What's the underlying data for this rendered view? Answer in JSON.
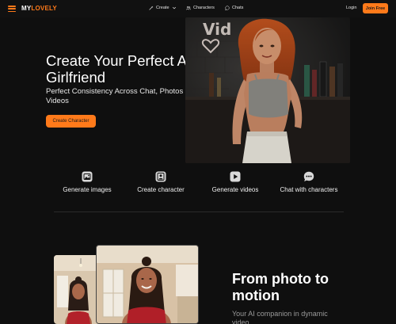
{
  "nav": {
    "logo_my": "MY",
    "logo_lovely": "LOVELY",
    "items": [
      {
        "label": "Create",
        "icon": "wand-icon"
      },
      {
        "label": "Characters",
        "icon": "people-icon"
      },
      {
        "label": "Chats",
        "icon": "chat-icon"
      }
    ],
    "login": "Login",
    "join": "Join Free"
  },
  "hero": {
    "title": "Create Your Perfect AI Girlfriend",
    "subtitle": "Perfect Consistency Across Chat, Photos & Videos",
    "cta": "Create Character",
    "neon_text": "Vid"
  },
  "features": [
    {
      "label": "Generate images",
      "icon": "image-icon"
    },
    {
      "label": "Create character",
      "icon": "person-card-icon"
    },
    {
      "label": "Generate videos",
      "icon": "play-icon"
    },
    {
      "label": "Chat with characters",
      "icon": "chat-bubble-icon"
    }
  ],
  "motion": {
    "title": "From photo to motion",
    "subtitle": "Your AI companion in dynamic video"
  },
  "colors": {
    "accent": "#ff7a1a",
    "background": "#0f0f0f"
  }
}
